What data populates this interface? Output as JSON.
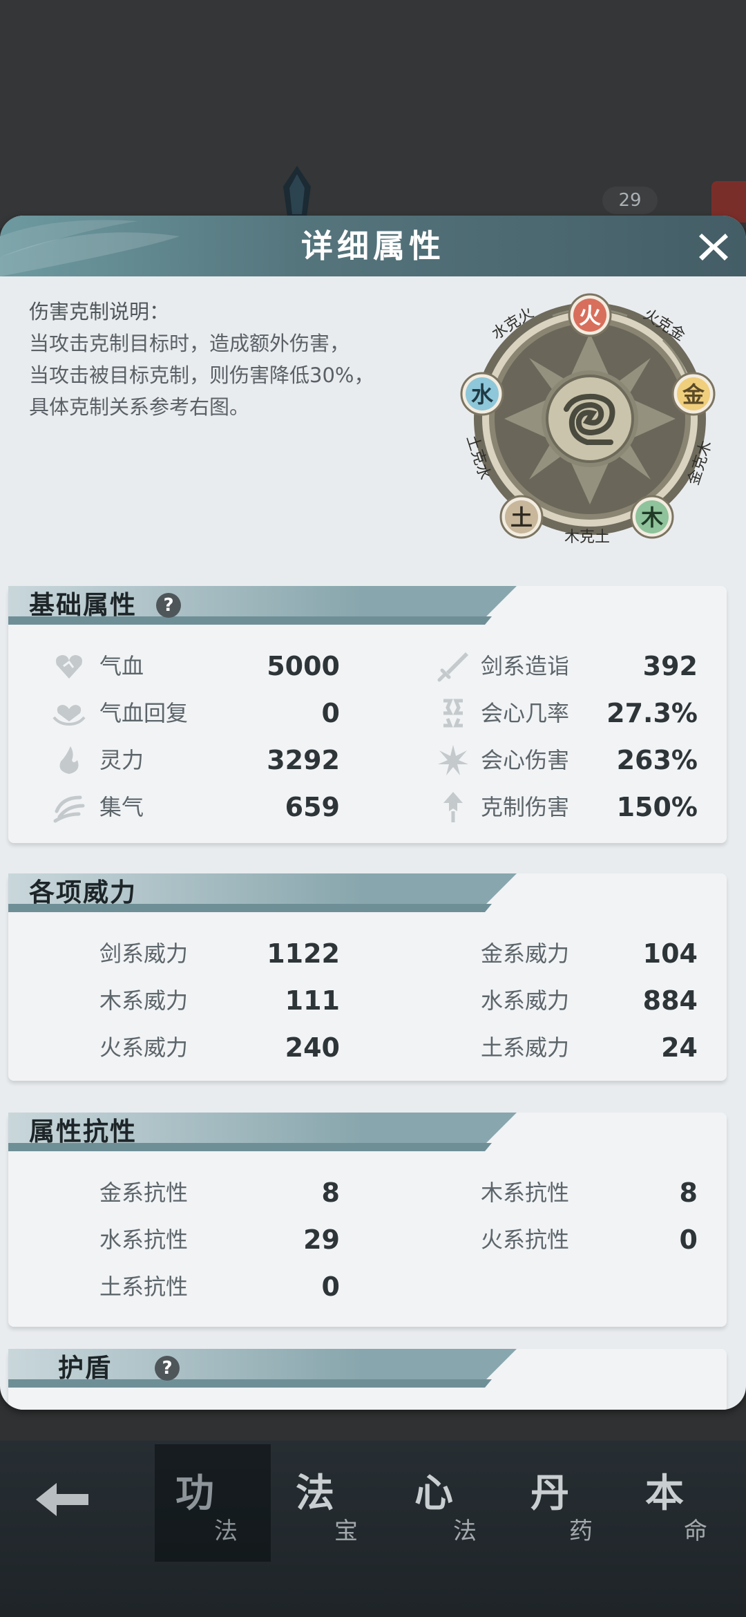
{
  "background": {
    "badge": "29"
  },
  "dialog": {
    "title": "详细属性",
    "description": [
      "伤害克制说明：",
      "当攻击克制目标时，造成额外伤害，",
      "当攻击被目标克制，则伤害降低30%，",
      "具体克制关系参考右图。"
    ],
    "wheel": {
      "elements": {
        "fire": "火",
        "metal": "金",
        "wood": "木",
        "earth": "土",
        "water": "水"
      },
      "relations": {
        "fire_metal": "火克金",
        "metal_wood": "金克木",
        "wood_earth": "木克土",
        "earth_water": "土克水",
        "water_fire": "水克火"
      }
    }
  },
  "basic": {
    "title": "基础属性",
    "help": "?",
    "left": [
      {
        "label": "气血",
        "value": "5000",
        "icon": "heart-icon"
      },
      {
        "label": "气血回复",
        "value": "0",
        "icon": "regen-icon"
      },
      {
        "label": "灵力",
        "value": "3292",
        "icon": "flame-icon"
      },
      {
        "label": "集气",
        "value": "659",
        "icon": "swirl-icon"
      }
    ],
    "right": [
      {
        "label": "剑系造诣",
        "value": "392",
        "icon": "sword-icon"
      },
      {
        "label": "会心几率",
        "value": "27.3%",
        "icon": "crit-rate-icon"
      },
      {
        "label": "会心伤害",
        "value": "263%",
        "icon": "crit-damage-icon"
      },
      {
        "label": "克制伤害",
        "value": "150%",
        "icon": "counter-icon"
      }
    ]
  },
  "power": {
    "title": "各项威力",
    "left": [
      {
        "label": "剑系威力",
        "value": "1122"
      },
      {
        "label": "木系威力",
        "value": "111"
      },
      {
        "label": "火系威力",
        "value": "240"
      }
    ],
    "right": [
      {
        "label": "金系威力",
        "value": "104"
      },
      {
        "label": "水系威力",
        "value": "884"
      },
      {
        "label": "土系威力",
        "value": "24"
      }
    ]
  },
  "resist": {
    "title": "属性抗性",
    "left": [
      {
        "label": "金系抗性",
        "value": "8"
      },
      {
        "label": "水系抗性",
        "value": "29"
      },
      {
        "label": "土系抗性",
        "value": "0"
      }
    ],
    "right": [
      {
        "label": "木系抗性",
        "value": "8"
      },
      {
        "label": "火系抗性",
        "value": "0"
      }
    ]
  },
  "shield": {
    "title": "护盾",
    "help": "?"
  },
  "bottom_nav": [
    {
      "big": "功",
      "small": "法"
    },
    {
      "big": "法",
      "small": "宝"
    },
    {
      "big": "心",
      "small": "法"
    },
    {
      "big": "丹",
      "small": "药"
    },
    {
      "big": "本",
      "small": "命"
    }
  ]
}
